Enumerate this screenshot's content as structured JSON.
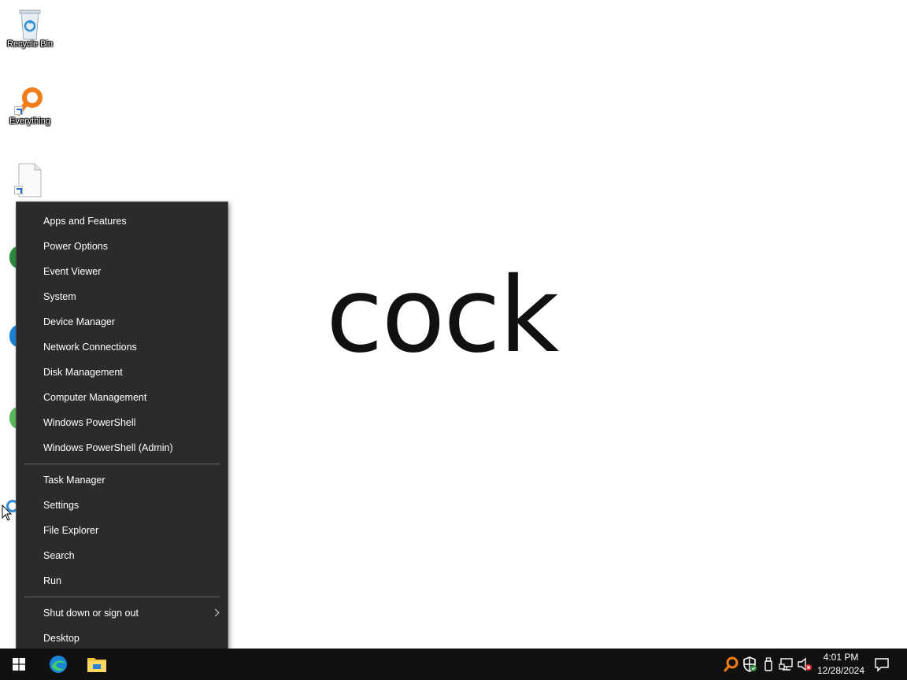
{
  "desktop": {
    "icons": [
      {
        "label": "Recycle Bin",
        "icon": "recycle-bin-icon"
      },
      {
        "label": "Everything",
        "icon": "everything-search-icon"
      },
      {
        "label": "",
        "icon": "blank-file-icon"
      }
    ],
    "word": "cock"
  },
  "context_menu": {
    "items": [
      "Apps and Features",
      "Power Options",
      "Event Viewer",
      "System",
      "Device Manager",
      "Network Connections",
      "Disk Management",
      "Computer Management",
      "Windows PowerShell",
      "Windows PowerShell (Admin)",
      "Task Manager",
      "Settings",
      "File Explorer",
      "Search",
      "Run",
      "Shut down or sign out",
      "Desktop"
    ]
  },
  "taskbar": {
    "pinned": [
      "start-windows-icon",
      "edge-icon",
      "file-explorer-icon"
    ],
    "tray": [
      "everything-tray-icon",
      "defender-shield-icon",
      "usb-device-icon",
      "network-icon",
      "volume-muted-icon"
    ],
    "time": "4:01 PM",
    "date": "12/28/2024",
    "notification": "action-center-icon"
  },
  "colors": {
    "menu_bg": "#2b2b2b",
    "taskbar_bg": "#111111",
    "everything_orange": "#f07c1a",
    "edge_blue": "#1b84d8"
  }
}
